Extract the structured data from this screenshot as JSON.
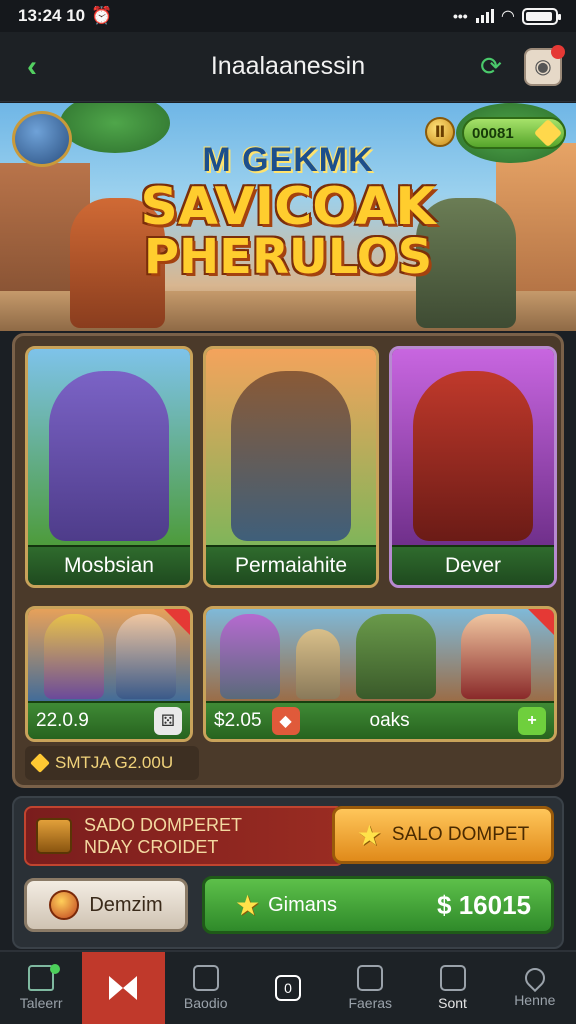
{
  "status_bar": {
    "time": "13:24 10",
    "alarm_icon": "alarm-icon"
  },
  "header": {
    "title": "Inaalaanessin"
  },
  "hero": {
    "subtitle": "M GEKMK",
    "title_line1": "SAVICOAK",
    "title_line2": "PHERULOS",
    "coin_symbol": "Ⅱ",
    "currency_value": "00081"
  },
  "cards": [
    {
      "label": "Mosbsian",
      "color": "#2f6b2d"
    },
    {
      "label": "Permaiahite",
      "color": "#2f6b2d"
    },
    {
      "label": "Dever",
      "color": "#2f6b2d"
    }
  ],
  "wide_cards": [
    {
      "price": "22.0.9"
    },
    {
      "price": "$2.05",
      "label": "oaks"
    }
  ],
  "offer_strip": {
    "label": "SMTJA G2.00U"
  },
  "promo": {
    "line1": "SADO DOMPERET",
    "line2": "NDAY CROIDET",
    "button": "SALO DOMPET"
  },
  "actions": {
    "secondary": "Demzim",
    "primary": "Gimans",
    "price": "$ 16015"
  },
  "bottom_nav": [
    {
      "label": "Taleerr"
    },
    {
      "label": ""
    },
    {
      "label": "Baodio"
    },
    {
      "label": "0"
    },
    {
      "label": "Faeras"
    },
    {
      "label": "Sont"
    },
    {
      "label": "Henne"
    }
  ],
  "colors": {
    "accent_green": "#4ac96b",
    "nav_active": "#c0392b",
    "title_gold": "#ffcd2e"
  }
}
